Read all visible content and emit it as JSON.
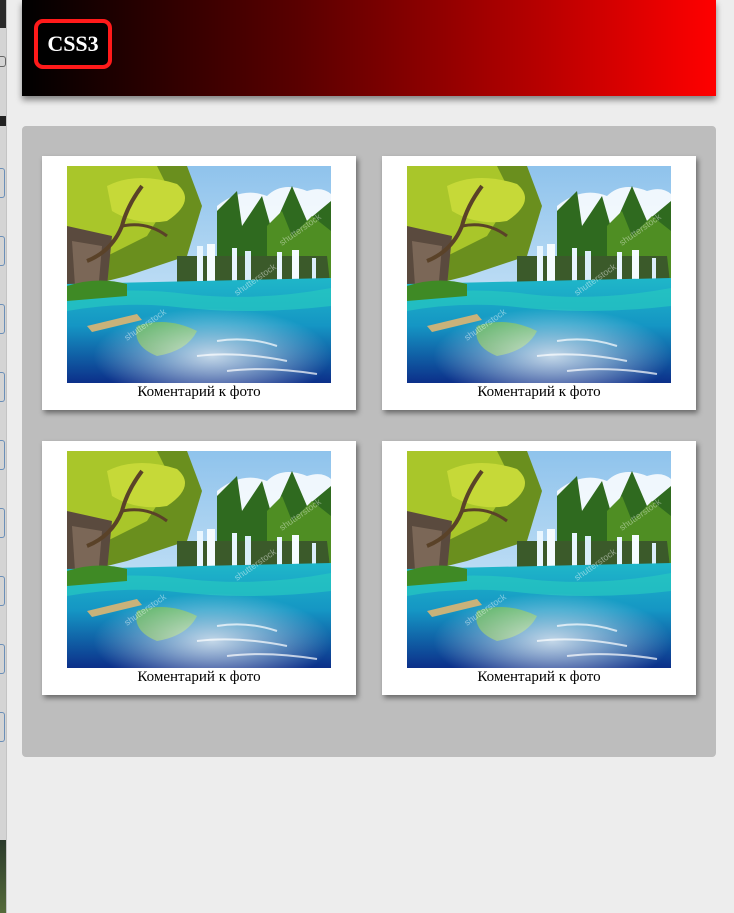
{
  "header": {
    "logo_text": "CSS3",
    "gradient_start": "#000000",
    "gradient_end": "#ff0000",
    "logo_border_color": "#ff1a1a"
  },
  "gallery": {
    "background": "#bdbdbd",
    "items": [
      {
        "image": "waterfall-lake-photo",
        "caption": "Коментарий к фото"
      },
      {
        "image": "waterfall-lake-photo",
        "caption": "Коментарий к фото"
      },
      {
        "image": "waterfall-lake-photo",
        "caption": "Коментарий к фото"
      },
      {
        "image": "waterfall-lake-photo",
        "caption": "Коментарий к фото"
      }
    ]
  }
}
